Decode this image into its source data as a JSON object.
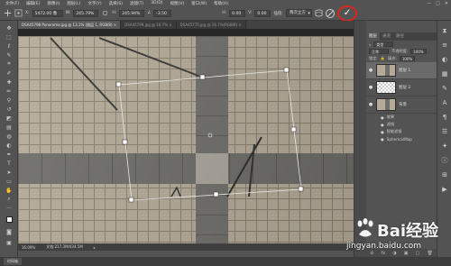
{
  "menubar": {
    "items": [
      "文件(F)",
      "编辑(E)",
      "图像(I)",
      "图层(L)",
      "文字(Y)",
      "选择(S)",
      "滤镜(T)",
      "3D(D)",
      "视图(V)",
      "窗口(W)",
      "帮助(H)"
    ],
    "window_controls": [
      "—",
      "□",
      "✕"
    ]
  },
  "options_bar": {
    "x_label": "X:",
    "x_value": "5472.00 像",
    "w_label": "W:",
    "w_value": "245.79%",
    "h_label": "H:",
    "h_value": "245.94%",
    "angle_label": "∠",
    "angle_value": "-3.50",
    "hskew_label": "H:",
    "hskew_value": "0.00",
    "vskew_label": "V:",
    "vskew_value": "0.00",
    "interpolation_label": "插值:",
    "interpolation_value": "两次立方",
    "commit_symbol": "✓",
    "accent": "#d9261c"
  },
  "doc_tabs": [
    {
      "label": "DSA45798 Panorama.jpg @ 13.1% (图层 1, RGB/8) ×",
      "active": true
    },
    {
      "label": "DSA45799.jpg @ 16.7% ×",
      "active": false
    },
    {
      "label": "DSA45775.jpg @ 16.7%(RGB/8) ×",
      "active": false
    }
  ],
  "status_bar": {
    "zoom": "16.09%",
    "doc_size": "文档:217.3M/434.5M",
    "arrow": "▸"
  },
  "timeline": {
    "label": "时间轴"
  },
  "layers_panel": {
    "tabs": [
      "图层",
      "通道",
      "路径"
    ],
    "kind_label": "类型",
    "blend_mode": "正常",
    "opacity_label": "不透明度:",
    "opacity_value": "100%",
    "lock_label": "锁定:",
    "fill_label": "填充:",
    "fill_value": "100%",
    "layers": [
      {
        "name": "图层 1",
        "selected": true,
        "thumb": "tiles"
      },
      {
        "name": "图层 2",
        "selected": false,
        "thumb": "checker"
      },
      {
        "name": "背景",
        "selected": false,
        "thumb": "tiles"
      }
    ],
    "effects": [
      "效果",
      "滤镜",
      "智能滤镜",
      "SphericalMap"
    ],
    "bottom_icons": [
      "⊘",
      "fx",
      "◑",
      "▣",
      "▢",
      "🗑"
    ]
  },
  "watermark": {
    "title": "Bai经验",
    "url": "jingyan.baidu.com"
  }
}
